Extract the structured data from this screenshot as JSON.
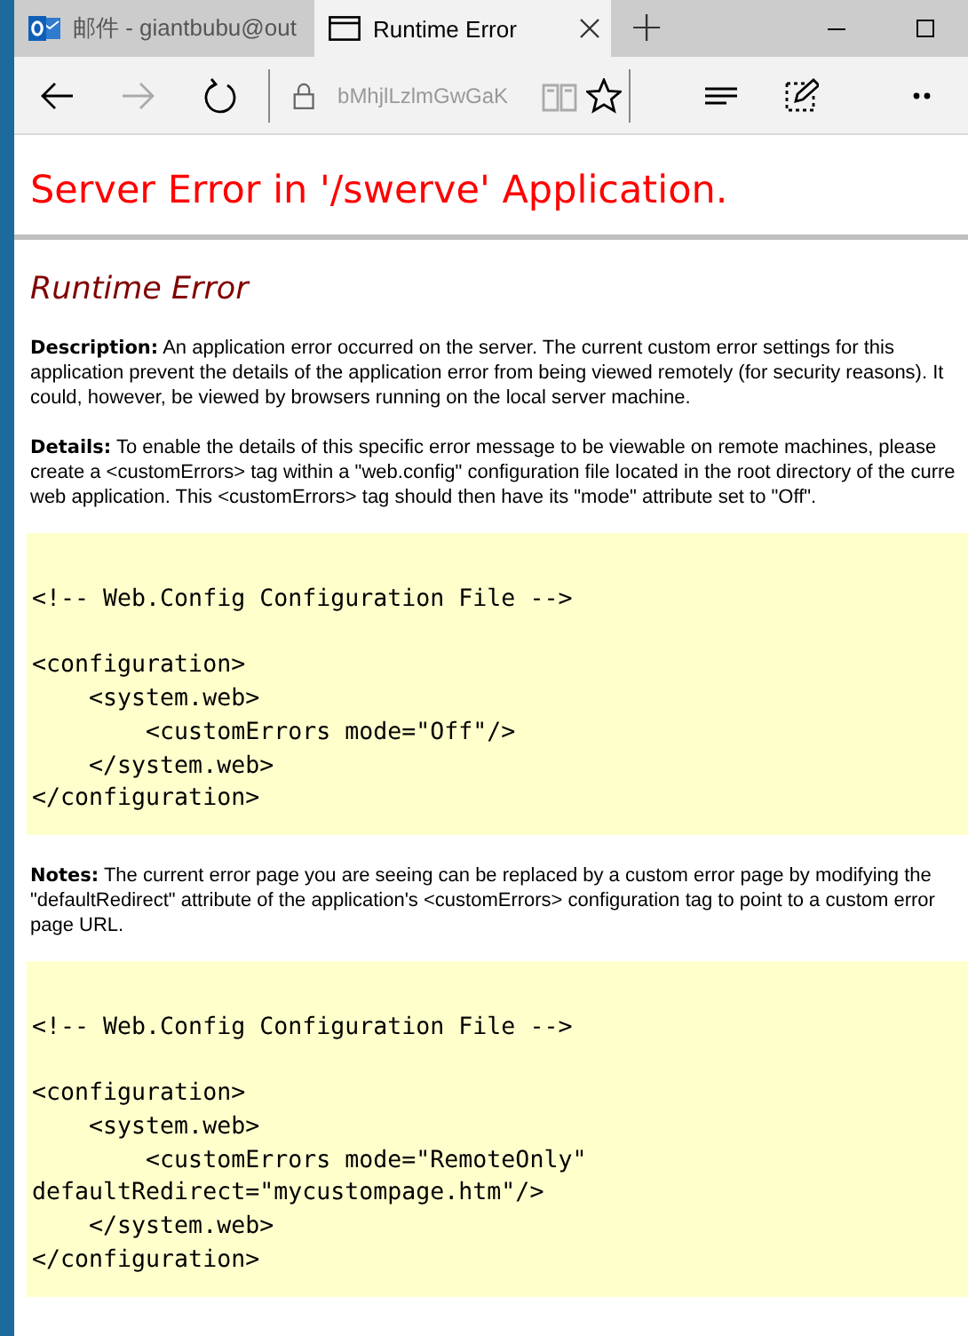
{
  "browser": {
    "tabs": [
      {
        "label": "邮件 - giantbubu@out",
        "kind": "mail",
        "selected": false
      },
      {
        "label": "Runtime Error",
        "kind": "page",
        "selected": true
      }
    ],
    "new_tab": "+",
    "toolbar": [
      {
        "kind": "back",
        "disabled": false
      },
      {
        "kind": "forward",
        "disabled": true
      },
      {
        "kind": "refresh",
        "disabled": false
      },
      {
        "kind": "address",
        "text": "bMhjlLzlmGwGaK"
      },
      {
        "kind": "reading",
        "disabled": true
      },
      {
        "kind": "favorite",
        "disabled": false
      },
      {
        "kind": "hub",
        "disabled": false
      },
      {
        "kind": "note",
        "disabled": false
      },
      {
        "kind": "more",
        "disabled": false
      }
    ]
  },
  "page": {
    "title": "Server Error in '/swerve' Application.",
    "subtitle": "Runtime Error",
    "sections": [
      {
        "kind": "paragraph",
        "text": "**Description:** An application error occurred on the server. The current custom error settings for this\napplication prevent the details of the application error from being viewed remotely (for security reasons). It\ncould, however, be viewed by browsers running on the local server machine."
      },
      {
        "kind": "paragraph",
        "text": "**Details:** To enable the details of this specific error message to be viewable on remote machines, please\ncreate a <customErrors> tag within a \"web.config\" configuration file located in the root directory of the curre\nweb application. This <customErrors> tag should then have its \"mode\" attribute set to \"Off\"."
      },
      {
        "kind": "code",
        "blocks": [
          [
            "<!-- Web.Config Configuration File -->"
          ],
          [
            "<configuration>",
            "    <system.web>",
            "        <customErrors mode=\"Off\"/>",
            "    </system.web>",
            "</configuration>"
          ]
        ]
      },
      {
        "kind": "paragraph",
        "text": "**Notes:** The current error page you are seeing can be replaced by a custom error page by modifying the\n\"defaultRedirect\" attribute of the application's <customErrors> configuration tag to point to a custom error\npage URL."
      },
      {
        "kind": "code",
        "blocks": [
          [
            "<!-- Web.Config Configuration File -->"
          ],
          [
            "<configuration>",
            "    <system.web>",
            "        <customErrors mode=\"RemoteOnly\"",
            "defaultRedirect=\"mycustompage.htm\"/>",
            "    </system.web>",
            "</configuration>"
          ]
        ]
      }
    ]
  }
}
